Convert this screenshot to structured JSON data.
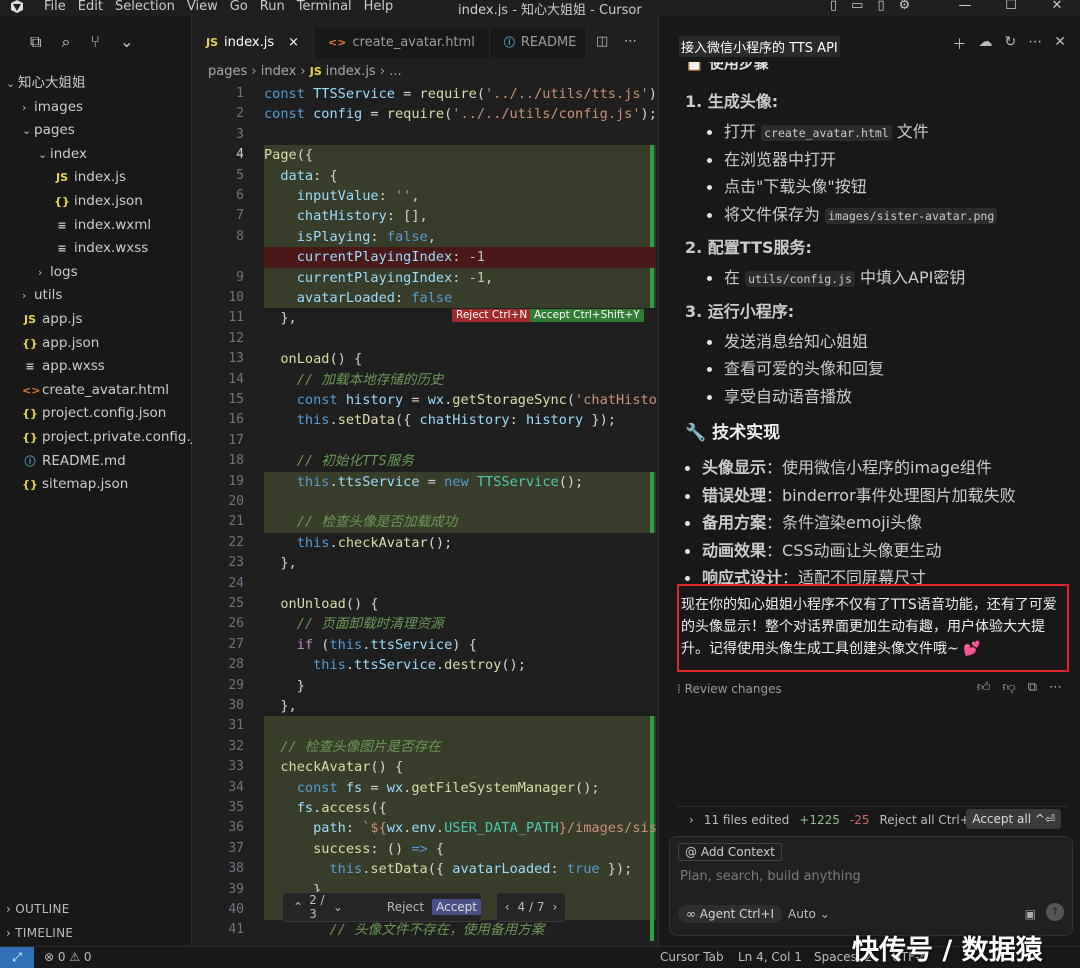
{
  "titlebar": {
    "menu": [
      "File",
      "Edit",
      "Selection",
      "View",
      "Go",
      "Run",
      "Terminal",
      "Help"
    ],
    "title": "index.js - 知心大姐姐 - Cursor"
  },
  "sidebar": {
    "root": "知心大姐姐",
    "items": [
      {
        "label": "images",
        "type": "folder",
        "depth": 1,
        "open": false
      },
      {
        "label": "pages",
        "type": "folder",
        "depth": 1,
        "open": true
      },
      {
        "label": "index",
        "type": "folder",
        "depth": 2,
        "open": true
      },
      {
        "label": "index.js",
        "type": "js",
        "depth": 3
      },
      {
        "label": "index.json",
        "type": "json",
        "depth": 3
      },
      {
        "label": "index.wxml",
        "type": "xml",
        "depth": 3
      },
      {
        "label": "index.wxss",
        "type": "xml",
        "depth": 3
      },
      {
        "label": "logs",
        "type": "folder",
        "depth": 2,
        "open": false
      },
      {
        "label": "utils",
        "type": "folder",
        "depth": 1,
        "open": false
      },
      {
        "label": "app.js",
        "type": "js",
        "depth": 1
      },
      {
        "label": "app.json",
        "type": "json",
        "depth": 1
      },
      {
        "label": "app.wxss",
        "type": "xml",
        "depth": 1
      },
      {
        "label": "create_avatar.html",
        "type": "html",
        "depth": 1
      },
      {
        "label": "project.config.json",
        "type": "json",
        "depth": 1
      },
      {
        "label": "project.private.config.js...",
        "type": "json",
        "depth": 1
      },
      {
        "label": "README.md",
        "type": "md",
        "depth": 1
      },
      {
        "label": "sitemap.json",
        "type": "json",
        "depth": 1
      }
    ],
    "outline": "OUTLINE",
    "timeline": "TIMELINE"
  },
  "editor": {
    "tabs": [
      {
        "label": "index.js",
        "icon": "JS",
        "active": true,
        "close": "×"
      },
      {
        "label": "create_avatar.html",
        "icon": "<>",
        "active": false
      },
      {
        "label": "README",
        "icon": "ⓘ",
        "active": false
      }
    ],
    "breadcrumb": [
      "pages",
      "index",
      "index.js",
      "..."
    ],
    "reject_label": "Reject Ctrl+N",
    "accept_label": "Accept Ctrl+Shift+Y",
    "lines": [
      {
        "n": "1",
        "html": "<span class='k'>const</span> <span class='v'>TTSService</span> = <span class='f'>require</span>(<span class='s'>'../../utils/tts.js'</span>);"
      },
      {
        "n": "2",
        "html": "<span class='k'>const</span> <span class='v'>config</span> = <span class='f'>require</span>(<span class='s'>'../../utils/config.js'</span>);"
      },
      {
        "n": "3",
        "html": ""
      },
      {
        "n": "4",
        "html": "<span class='f'>Page</span>({"
      },
      {
        "n": "5",
        "html": "  <span class='v'>data</span>: {"
      },
      {
        "n": "6",
        "html": "    <span class='v'>inputValue</span>: <span class='s'>''</span>,"
      },
      {
        "n": "7",
        "html": "    <span class='v'>chatHistory</span>: [],"
      },
      {
        "n": "8",
        "html": "    <span class='v'>isPlaying</span>: <span class='k'>false</span>,"
      },
      {
        "n": "",
        "html": "    <span class='v'>currentPlayingIndex</span>: <span class='n'>-1</span>"
      },
      {
        "n": "9",
        "html": "    <span class='v'>currentPlayingIndex</span>: <span class='n'>-1</span>,"
      },
      {
        "n": "10",
        "html": "    <span class='v'>avatarLoaded</span>: <span class='k'>false</span>"
      },
      {
        "n": "11",
        "html": "  },"
      },
      {
        "n": "12",
        "html": ""
      },
      {
        "n": "13",
        "html": "  <span class='f'>onLoad</span>() {"
      },
      {
        "n": "14",
        "html": "    <span class='c'>// 加载本地存储的历史</span>"
      },
      {
        "n": "15",
        "html": "    <span class='k'>const</span> <span class='v'>history</span> = <span class='v'>wx</span>.<span class='f'>getStorageSync</span>(<span class='s'>'chatHisto</span>"
      },
      {
        "n": "16",
        "html": "    <span class='k'>this</span>.<span class='f'>setData</span>({ <span class='v'>chatHistory</span>: <span class='v'>history</span> });"
      },
      {
        "n": "17",
        "html": ""
      },
      {
        "n": "18",
        "html": "    <span class='c'>// 初始化TTS服务</span>"
      },
      {
        "n": "19",
        "html": "    <span class='k'>this</span>.<span class='v'>ttsService</span> = <span class='k'>new</span> <span class='t'>TTSService</span>();"
      },
      {
        "n": "20",
        "html": ""
      },
      {
        "n": "21",
        "html": "    <span class='c'>// 检查头像是否加载成功</span>"
      },
      {
        "n": "22",
        "html": "    <span class='k'>this</span>.<span class='f'>checkAvatar</span>();"
      },
      {
        "n": "23",
        "html": "  },"
      },
      {
        "n": "24",
        "html": ""
      },
      {
        "n": "25",
        "html": "  <span class='f'>onUnload</span>() {"
      },
      {
        "n": "26",
        "html": "    <span class='c'>// 页面卸载时清理资源</span>"
      },
      {
        "n": "27",
        "html": "    <span class='p'>if</span> (<span class='k'>this</span>.<span class='v'>ttsService</span>) {"
      },
      {
        "n": "28",
        "html": "      <span class='k'>this</span>.<span class='v'>ttsService</span>.<span class='f'>destroy</span>();"
      },
      {
        "n": "29",
        "html": "    }"
      },
      {
        "n": "30",
        "html": "  },"
      },
      {
        "n": "31",
        "html": ""
      },
      {
        "n": "32",
        "html": "  <span class='c'>// 检查头像图片是否存在</span>"
      },
      {
        "n": "33",
        "html": "  <span class='f'>checkAvatar</span>() {"
      },
      {
        "n": "34",
        "html": "    <span class='k'>const</span> <span class='v'>fs</span> = <span class='v'>wx</span>.<span class='f'>getFileSystemManager</span>();"
      },
      {
        "n": "35",
        "html": "    <span class='v'>fs</span>.<span class='f'>access</span>({"
      },
      {
        "n": "36",
        "html": "      <span class='v'>path</span>: <span class='s'>`${</span><span class='v'>wx</span>.<span class='v'>env</span>.<span class='t'>USER_DATA_PATH</span><span class='s'>}/images/sis</span>"
      },
      {
        "n": "37",
        "html": "      <span class='f'>success</span>: () <span class='k'>=></span> {"
      },
      {
        "n": "38",
        "html": "        <span class='k'>this</span>.<span class='f'>setData</span>({ <span class='v'>avatarLoaded</span>: <span class='k'>true</span> });"
      },
      {
        "n": "39",
        "html": "      },"
      },
      {
        "n": "40",
        "html": "      <span class='f'>fail</span>: () <span class='k'>=></span> {"
      },
      {
        "n": "41",
        "html": "        <span class='c'>// 头像文件不存在，使用备用方案</span>"
      }
    ],
    "diff_nav": {
      "count": "2 / 3",
      "reject": "Reject",
      "accept": "Accept",
      "files": "4 / 7"
    }
  },
  "chat": {
    "title": "接入微信小程序的 TTS API",
    "section_cut": "📋 使用步骤",
    "steps": [
      {
        "title": "1. 生成头像:",
        "bullets": [
          {
            "pre": "打开 ",
            "code": "create_avatar.html",
            "post": " 文件"
          },
          {
            "pre": "在浏览器中打开",
            "code": "",
            "post": ""
          },
          {
            "pre": "点击\"下载头像\"按钮",
            "code": "",
            "post": ""
          },
          {
            "pre": "将文件保存为 ",
            "code": "images/sister-avatar.png",
            "post": ""
          }
        ]
      },
      {
        "title": "2. 配置TTS服务:",
        "bullets": [
          {
            "pre": "在 ",
            "code": "utils/config.js",
            "post": " 中填入API密钥"
          }
        ]
      },
      {
        "title": "3. 运行小程序:",
        "bullets": [
          {
            "pre": "发送消息给知心姐姐",
            "code": "",
            "post": ""
          },
          {
            "pre": "查看可爱的头像和回复",
            "code": "",
            "post": ""
          },
          {
            "pre": "享受自动语音播放",
            "code": "",
            "post": ""
          }
        ]
      }
    ],
    "tech_heading": "🔧 技术实现",
    "tech_items": [
      {
        "k": "头像显示",
        "v": "：使用微信小程序的image组件"
      },
      {
        "k": "错误处理",
        "v": "：binderror事件处理图片加载失败"
      },
      {
        "k": "备用方案",
        "v": "：条件渲染emoji头像"
      },
      {
        "k": "动画效果",
        "v": "：CSS动画让头像更生动"
      },
      {
        "k": "响应式设计",
        "v": "：适配不同屏幕尺寸"
      }
    ],
    "highlight": "现在你的知心姐姐小程序不仅有了TTS语音功能，还有了可爱的头像显示！整个对话界面更加生动有趣，用户体验大大提升。记得使用头像生成工具创建头像文件哦~ 💕",
    "review": "Review changes",
    "edited": {
      "files": "11 files edited",
      "added": "+1225",
      "removed": "-25",
      "reject_all": "Reject all Ctrl+Shift+⌫",
      "accept_all": "Accept all ^⏎"
    },
    "add_context": "@ Add Context",
    "placeholder": "Plan, search, build anything",
    "agent": "∞ Agent Ctrl+I",
    "auto": "Auto"
  },
  "statusbar": {
    "problems": "⊗ 0 ⚠ 0",
    "cursor_tab": "Cursor Tab",
    "position": "Ln 4, Col 1",
    "spaces": "Spaces: 2",
    "enc": "UTF-8"
  },
  "watermark": "快传号 / 数据猿"
}
